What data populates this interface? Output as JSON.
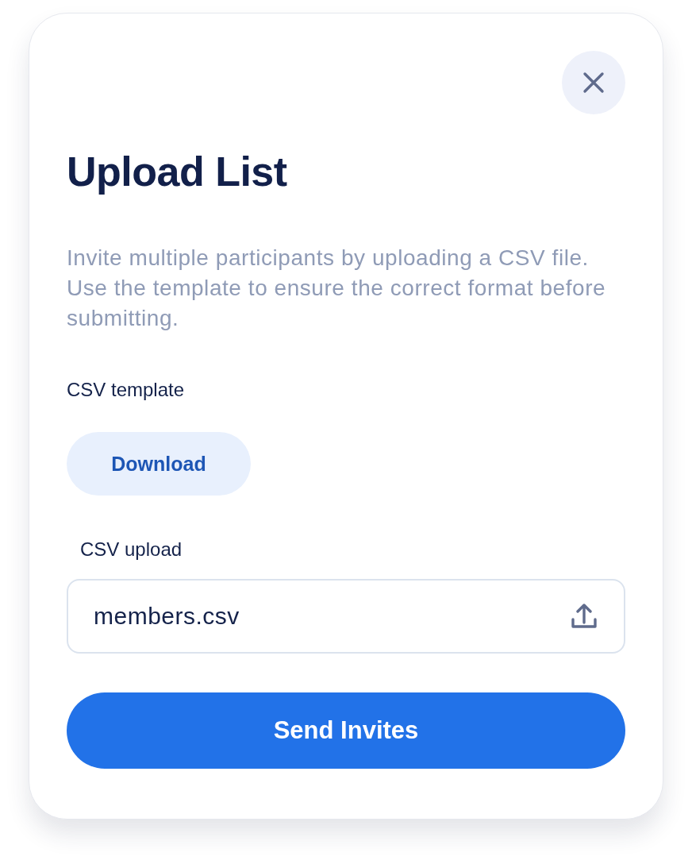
{
  "dialog": {
    "title": "Upload List",
    "description": "Invite multiple participants by uploading a CSV file. Use the template to ensure the correct format before submitting.",
    "template_label": "CSV template",
    "download_button": "Download",
    "upload_label": "CSV upload",
    "upload_field": {
      "value": "members.csv"
    },
    "submit_button": "Send Invites"
  }
}
